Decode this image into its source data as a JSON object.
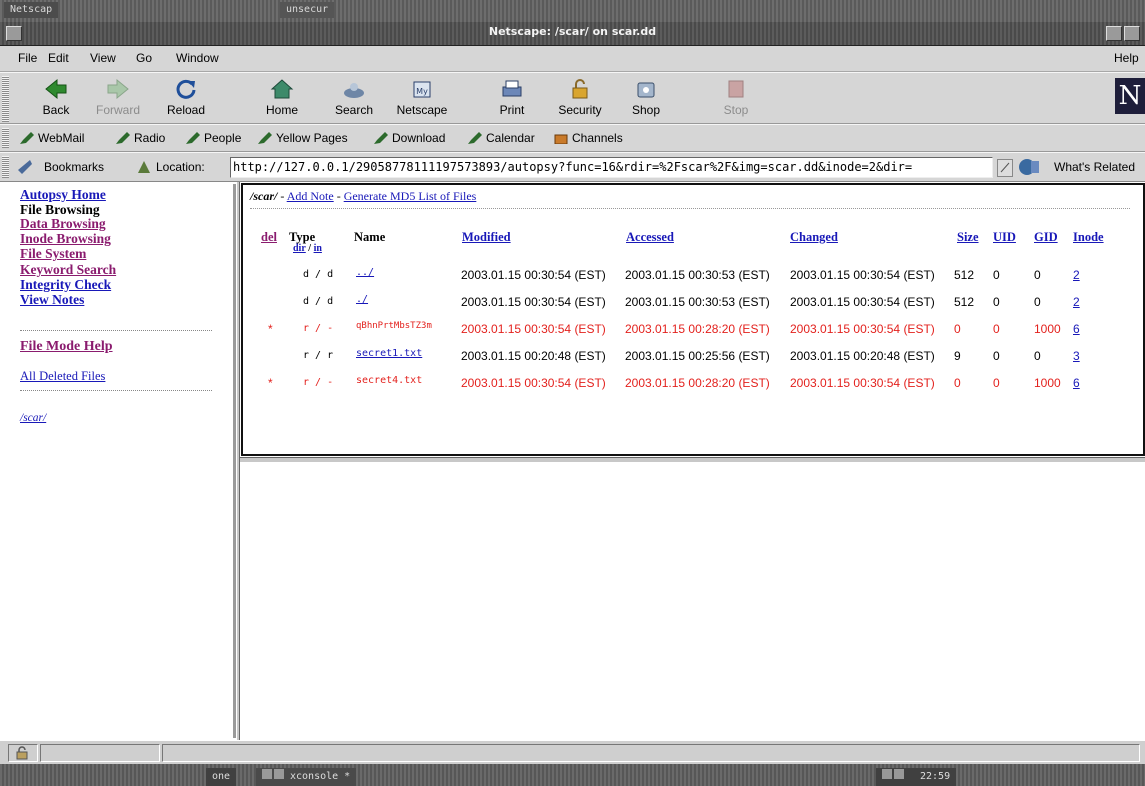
{
  "desktop": {
    "top_tab1": "Netscap",
    "top_tab2": "unsecur",
    "clock": "22:59",
    "pager": "one",
    "xconsole": "xconsole *"
  },
  "window": {
    "title": "Netscape: /scar/ on scar.dd"
  },
  "menu": {
    "file": "File",
    "edit": "Edit",
    "view": "View",
    "go": "Go",
    "window": "Window",
    "help": "Help"
  },
  "toolbar": {
    "back": "Back",
    "forward": "Forward",
    "reload": "Reload",
    "home": "Home",
    "search": "Search",
    "netscape": "Netscape",
    "print": "Print",
    "security": "Security",
    "shop": "Shop",
    "stop": "Stop",
    "logo": "N"
  },
  "personal_bar": {
    "webmail": "WebMail",
    "radio": "Radio",
    "people": "People",
    "yellow_pages": "Yellow Pages",
    "download": "Download",
    "calendar": "Calendar",
    "channels": "Channels"
  },
  "location_bar": {
    "bookmarks": "Bookmarks",
    "location_label": "Location:",
    "url": "http://127.0.0.1/29058778111197573893/autopsy?func=16&rdir=%2Fscar%2F&img=scar.dd&inode=2&dir=",
    "whats_related": "What's Related"
  },
  "left_nav": {
    "autopsy_home": "Autopsy Home",
    "file_browsing": "File Browsing",
    "data_browsing": "Data Browsing",
    "inode_browsing": "Inode Browsing",
    "file_system": "File System",
    "keyword_search": "Keyword Search",
    "integrity_check": "Integrity Check",
    "view_notes": "View Notes",
    "file_mode_help": "File Mode Help",
    "all_deleted_files": "All Deleted Files",
    "dir_link": "/scar/"
  },
  "breadcrumb": {
    "path": "/scar/",
    "sep1": " - ",
    "add_note": "Add Note",
    "sep2": " - ",
    "md5": "Generate MD5 List of Files"
  },
  "table": {
    "headers": {
      "del": "del",
      "type": "Type",
      "type_dir": "dir",
      "type_slash": " / ",
      "type_in": "in",
      "name": "Name",
      "modified": "Modified",
      "accessed": "Accessed",
      "changed": "Changed",
      "size": "Size",
      "uid": "UID",
      "gid": "GID",
      "inode": "Inode"
    },
    "rows": [
      {
        "del": "",
        "type": "d / d",
        "name": "../",
        "modified": "2003.01.15 00:30:54 (EST)",
        "accessed": "2003.01.15 00:30:53 (EST)",
        "changed": "2003.01.15 00:30:54 (EST)",
        "size": "512",
        "uid": "0",
        "gid": "0",
        "inode": "2"
      },
      {
        "del": "",
        "type": "d / d",
        "name": "./",
        "modified": "2003.01.15 00:30:54 (EST)",
        "accessed": "2003.01.15 00:30:53 (EST)",
        "changed": "2003.01.15 00:30:54 (EST)",
        "size": "512",
        "uid": "0",
        "gid": "0",
        "inode": "2"
      },
      {
        "del": "*",
        "type": "r / -",
        "name": "qBhnPrtMbsTZ3m",
        "modified": "2003.01.15 00:30:54 (EST)",
        "accessed": "2003.01.15 00:28:20 (EST)",
        "changed": "2003.01.15 00:30:54 (EST)",
        "size": "0",
        "uid": "0",
        "gid": "1000",
        "inode": "6"
      },
      {
        "del": "",
        "type": "r / r",
        "name": "secret1.txt",
        "modified": "2003.01.15 00:20:48 (EST)",
        "accessed": "2003.01.15 00:25:56 (EST)",
        "changed": "2003.01.15 00:20:48 (EST)",
        "size": "9",
        "uid": "0",
        "gid": "0",
        "inode": "3"
      },
      {
        "del": "*",
        "type": "r / -",
        "name": "secret4.txt",
        "modified": "2003.01.15 00:30:54 (EST)",
        "accessed": "2003.01.15 00:28:20 (EST)",
        "changed": "2003.01.15 00:30:54 (EST)",
        "size": "0",
        "uid": "0",
        "gid": "1000",
        "inode": "6"
      }
    ]
  },
  "colors": {
    "link": "#1818b8",
    "visited": "#8a1b6e",
    "deleted": "#e3211d"
  }
}
